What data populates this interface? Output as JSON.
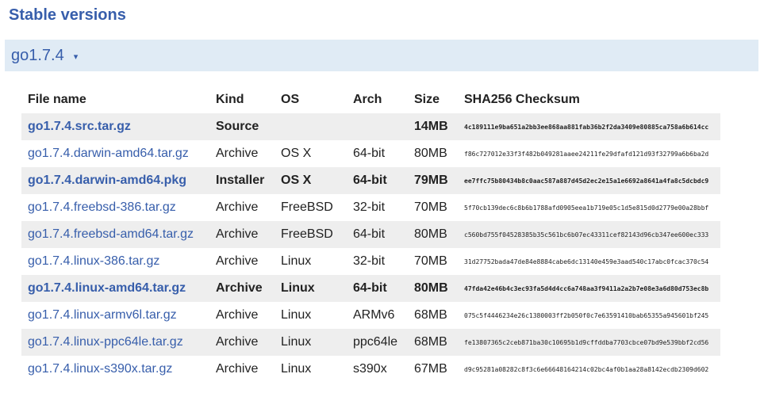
{
  "heading": "Stable versions",
  "version": {
    "label": "go1.7.4",
    "caret": "▾"
  },
  "table": {
    "columns": [
      "File name",
      "Kind",
      "OS",
      "Arch",
      "Size",
      "SHA256 Checksum"
    ],
    "rows": [
      {
        "file": "go1.7.4.src.tar.gz",
        "kind": "Source",
        "os": "",
        "arch": "",
        "size": "14MB",
        "checksum": "4c189111e9ba651a2bb3ee868aa881fab36b2f2da3409e80885ca758a6b614cc",
        "highlight": true
      },
      {
        "file": "go1.7.4.darwin-amd64.tar.gz",
        "kind": "Archive",
        "os": "OS X",
        "arch": "64-bit",
        "size": "80MB",
        "checksum": "f86c727012e33f3f482b049281aaee24211fe29dfafd121d93f32799a6b6ba2d",
        "highlight": false
      },
      {
        "file": "go1.7.4.darwin-amd64.pkg",
        "kind": "Installer",
        "os": "OS X",
        "arch": "64-bit",
        "size": "79MB",
        "checksum": "ee7ffc75b80434b8c0aac587a887d45d2ec2e15a1e6692a8641a4fa8c5dcbdc9",
        "highlight": true
      },
      {
        "file": "go1.7.4.freebsd-386.tar.gz",
        "kind": "Archive",
        "os": "FreeBSD",
        "arch": "32-bit",
        "size": "70MB",
        "checksum": "5f70cb139dec6c8b6b1788afd0905eea1b719e05c1d5e815d0d2779e00a28bbf",
        "highlight": false
      },
      {
        "file": "go1.7.4.freebsd-amd64.tar.gz",
        "kind": "Archive",
        "os": "FreeBSD",
        "arch": "64-bit",
        "size": "80MB",
        "checksum": "c560bd755f04528385b35c561bc6b07ec43311cef82143d96cb347ee600ec333",
        "highlight": false
      },
      {
        "file": "go1.7.4.linux-386.tar.gz",
        "kind": "Archive",
        "os": "Linux",
        "arch": "32-bit",
        "size": "70MB",
        "checksum": "31d27752bada47de84e8884cabe6dc13140e459e3aad540c17abc0fcac370c54",
        "highlight": false
      },
      {
        "file": "go1.7.4.linux-amd64.tar.gz",
        "kind": "Archive",
        "os": "Linux",
        "arch": "64-bit",
        "size": "80MB",
        "checksum": "47fda42e46b4c3ec93fa5d4d4cc6a748aa3f9411a2a2b7e08e3a6d80d753ec8b",
        "highlight": true
      },
      {
        "file": "go1.7.4.linux-armv6l.tar.gz",
        "kind": "Archive",
        "os": "Linux",
        "arch": "ARMv6",
        "size": "68MB",
        "checksum": "075c5f4446234e26c1380003ff2b050f0c7e63591410bab65355a945601bf245",
        "highlight": false
      },
      {
        "file": "go1.7.4.linux-ppc64le.tar.gz",
        "kind": "Archive",
        "os": "Linux",
        "arch": "ppc64le",
        "size": "68MB",
        "checksum": "fe13807365c2ceb871ba30c10695b1d9cffddba7703cbce07bd9e539bbf2cd56",
        "highlight": false
      },
      {
        "file": "go1.7.4.linux-s390x.tar.gz",
        "kind": "Archive",
        "os": "Linux",
        "arch": "s390x",
        "size": "67MB",
        "checksum": "d9c95281a08282c8f3c6e66648164214c02bc4af0b1aa28a8142ecdb2309d602",
        "highlight": false
      }
    ]
  }
}
